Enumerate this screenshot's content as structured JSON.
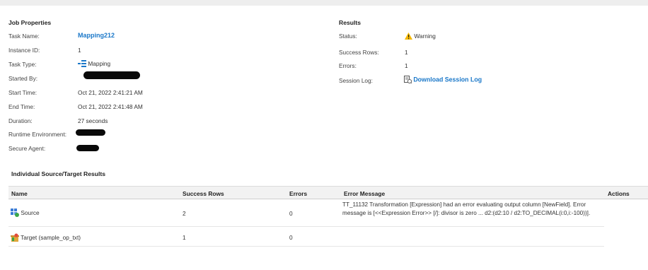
{
  "job_properties": {
    "title": "Job Properties",
    "fields": [
      {
        "label": "Task Name:",
        "value": "Mapping212"
      },
      {
        "label": "Instance ID:",
        "value": "1"
      },
      {
        "label": "Task Type:",
        "value": "Mapping",
        "icon": "mapping-icon"
      },
      {
        "label": "Started By:",
        "value": "",
        "redacted": true
      },
      {
        "label": "Start Time:",
        "value": "Oct 21, 2022 2:41:21 AM"
      },
      {
        "label": "End Time:",
        "value": "Oct 21, 2022 2:41:48 AM"
      },
      {
        "label": "Duration:",
        "value": "27 seconds"
      },
      {
        "label": "Runtime Environment:",
        "value": "",
        "redacted": true
      },
      {
        "label": "Secure Agent:",
        "value": "",
        "redacted": true
      }
    ]
  },
  "results": {
    "title": "Results",
    "fields": [
      {
        "label": "Status:",
        "value": "Warning",
        "icon": "warning-icon"
      },
      {
        "label": "Success Rows:",
        "value": "1"
      },
      {
        "label": "Errors:",
        "value": "1"
      },
      {
        "label": "Session Log:",
        "value": "Download Session Log",
        "icon": "download-log-icon"
      }
    ]
  },
  "source_target": {
    "title": "Individual Source/Target Results",
    "columns": [
      "Name",
      "Success Rows",
      "Errors",
      "Error Message",
      "Actions"
    ],
    "rows": [
      {
        "name": "Source",
        "icon": "source-icon",
        "success_rows": "2",
        "errors": "0",
        "error_message": "TT_11132 Transformation [Expression] had an error evaluating output column [NewField]. Error message is [<<Expression Error>> [/]: divisor is zero ... d2:(d2:10 / d2:TO_DECIMAL(i:0,i:-100))]."
      },
      {
        "name": "Target (sample_op_txt)",
        "icon": "target-icon",
        "success_rows": "1",
        "errors": "0",
        "error_message": ""
      }
    ]
  },
  "colors": {
    "link": "#1b78c9",
    "warning": "#f5b800",
    "header_bg": "#f2f2f2"
  }
}
